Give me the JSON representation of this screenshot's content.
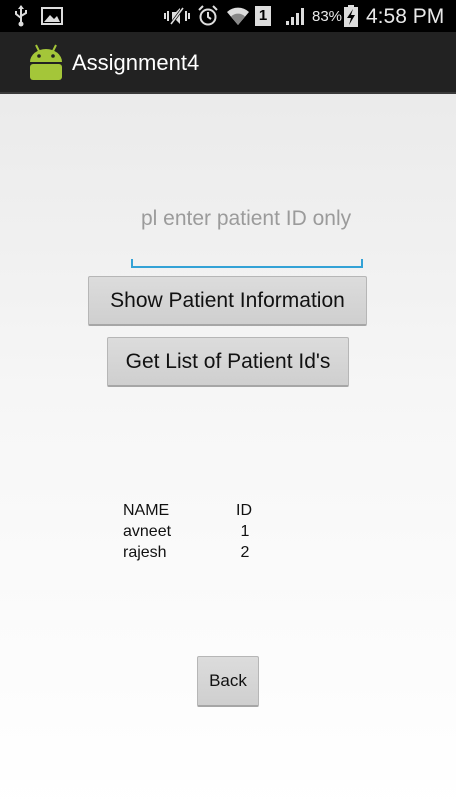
{
  "status_bar": {
    "battery_percent": "83%",
    "time": "4:58 PM",
    "sim_slot": "1",
    "icons": [
      "usb-icon",
      "image-icon",
      "mute-icon",
      "alarm-icon",
      "wifi-icon",
      "sim-icon",
      "signal-icon",
      "battery-charging-icon"
    ]
  },
  "action_bar": {
    "title": "Assignment4",
    "icon": "android-icon"
  },
  "form": {
    "patient_id_placeholder": "pl enter patient ID only",
    "patient_id_value": ""
  },
  "buttons": {
    "show_patient_info": "Show Patient Information",
    "get_patient_ids": "Get List of Patient Id's",
    "back": "Back"
  },
  "patient_list": {
    "headers": {
      "name": "NAME",
      "id": "ID"
    },
    "rows": [
      {
        "name": "avneet",
        "id": "1"
      },
      {
        "name": "rajesh",
        "id": "2"
      }
    ]
  },
  "colors": {
    "accent": "#33a2d6",
    "android_green": "#a4c639",
    "status_bar": "#000000",
    "action_bar": "#222222"
  }
}
